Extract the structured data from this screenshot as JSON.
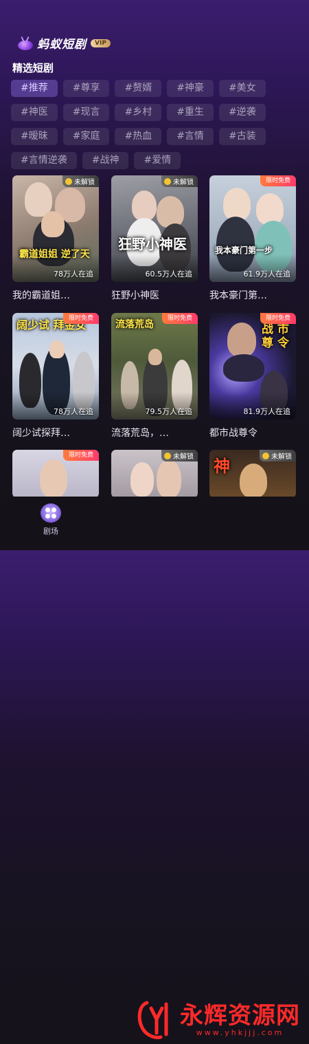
{
  "app": {
    "title": "蚂蚁短剧",
    "vip_label": "VIP"
  },
  "section": {
    "title": "精选短剧"
  },
  "tags": {
    "row1": [
      "#推荐",
      "#尊享",
      "#赘婿",
      "#神豪",
      "#美女"
    ],
    "row2": [
      "#神医",
      "#现言",
      "#乡村",
      "#重生",
      "#逆袭"
    ],
    "row3": [
      "#暧昧",
      "#家庭",
      "#热血",
      "#言情",
      "#古装"
    ],
    "row4": [
      "#言情逆袭",
      "#战神",
      "#爱情"
    ],
    "active": "#推荐"
  },
  "cards": [
    {
      "title": "我的霸道姐…",
      "badge": "未解锁",
      "views": "78万人在追",
      "overlay": "霸道姐姐 逆了天"
    },
    {
      "title": "狂野小神医",
      "badge": "未解锁",
      "views": "60.5万人在追",
      "overlay": "狂野小神医"
    },
    {
      "title": "我本豪门第…",
      "badge": "限时免费",
      "views": "61.9万人在追",
      "overlay": "我本豪门第一步"
    },
    {
      "title": "阔少试探拜…",
      "badge": "限时免费",
      "views": "78万人在追",
      "overlay": "阔少试 拜金女"
    },
    {
      "title": "流落荒岛，…",
      "badge": "限时免费",
      "views": "79.5万人在追",
      "overlay": "流落荒岛"
    },
    {
      "title": "都市战尊令",
      "badge": "限时免费",
      "views": "81.9万人在追",
      "overlay": "战 市 尊 令"
    },
    {
      "title": "",
      "badge": "限时免费",
      "views": "",
      "overlay": ""
    },
    {
      "title": "",
      "badge": "未解锁",
      "views": "",
      "overlay": ""
    },
    {
      "title": "",
      "badge": "未解锁",
      "views": "",
      "overlay": "神"
    }
  ],
  "tabbar": {
    "home_label": "剧场"
  },
  "watermark": {
    "text": "永辉资源网",
    "url": "www.yhkjjj.com"
  },
  "colors": {
    "accent": "#7b5bd8",
    "background": "#171320",
    "free_badge": "#ff3b6a",
    "lock_badge": "#4a4a4a"
  }
}
